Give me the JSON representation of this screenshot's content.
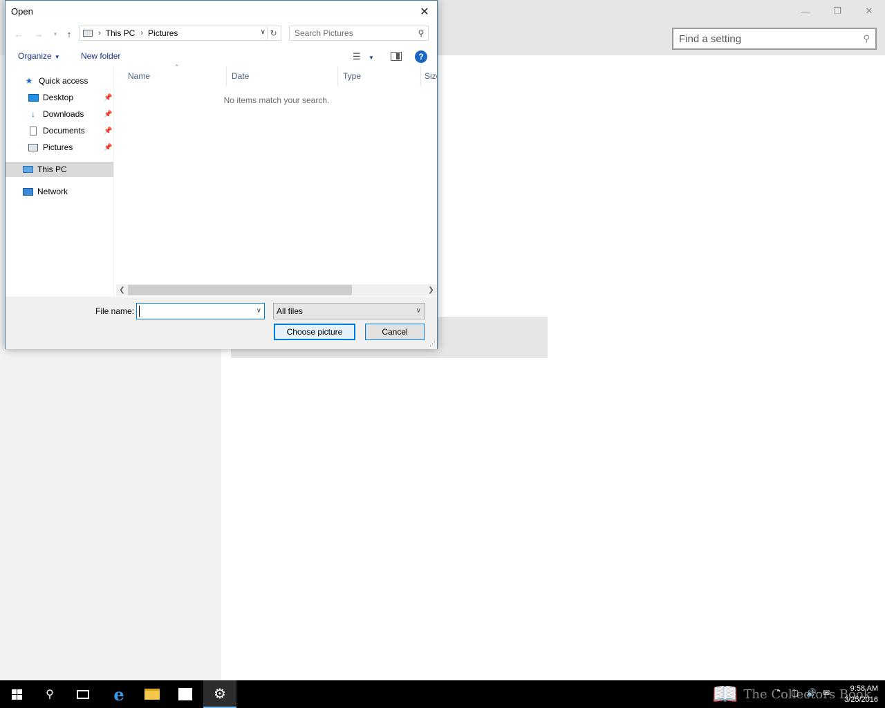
{
  "settings": {
    "search_placeholder": "Find a setting"
  },
  "dialog": {
    "title": "Open",
    "breadcrumb": [
      "This PC",
      "Pictures"
    ],
    "search_placeholder": "Search Pictures",
    "toolbar": {
      "organize_label": "Organize",
      "new_folder_label": "New folder",
      "help_label": "?"
    },
    "nav_pane": {
      "quick_access": "Quick access",
      "items": [
        {
          "label": "Desktop",
          "icon": "desktop-icon"
        },
        {
          "label": "Downloads",
          "icon": "downloads-icon"
        },
        {
          "label": "Documents",
          "icon": "documents-icon"
        },
        {
          "label": "Pictures",
          "icon": "pictures-icon"
        }
      ],
      "this_pc": "This PC",
      "network": "Network"
    },
    "columns": [
      "Name",
      "Date",
      "Type",
      "Size"
    ],
    "empty_message": "No items match your search.",
    "file_name_label": "File name:",
    "file_name_value": "",
    "file_type_selected": "All files",
    "choose_button": "Choose picture",
    "cancel_button": "Cancel"
  },
  "taskbar": {
    "watermark": "The Collectors Book",
    "time": "9:58 AM",
    "date": "3/25/2016"
  },
  "colors": {
    "accent": "#0078d7",
    "taskbar": "#000000",
    "help_icon": "#1a66c3"
  }
}
